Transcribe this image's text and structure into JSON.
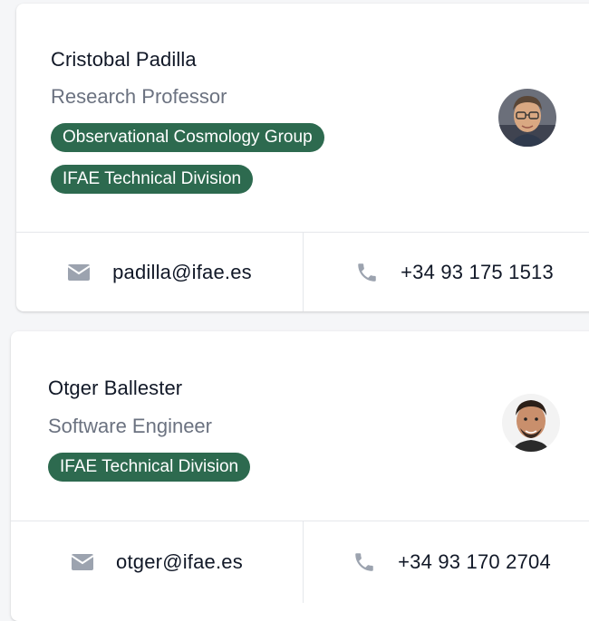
{
  "people": [
    {
      "name": "Cristobal Padilla",
      "title": "Research Professor",
      "groups": [
        "Observational Cosmology Group",
        "IFAE Technical Division"
      ],
      "email": "padilla@ifae.es",
      "phone": "+34 93 175 1513",
      "avatar_icon": "person-photo"
    },
    {
      "name": "Otger Ballester",
      "title": "Software Engineer",
      "groups": [
        "IFAE Technical Division"
      ],
      "email": "otger@ifae.es",
      "phone": "+34 93 170 2704",
      "avatar_icon": "person-photo"
    }
  ],
  "icons": {
    "email": "mail-icon",
    "phone": "phone-icon"
  },
  "colors": {
    "badge_bg": "#2d6a4f",
    "badge_text": "#ffffff",
    "icon_gray": "#9ca3af",
    "name_text": "#111827",
    "title_text": "#6b7280"
  }
}
